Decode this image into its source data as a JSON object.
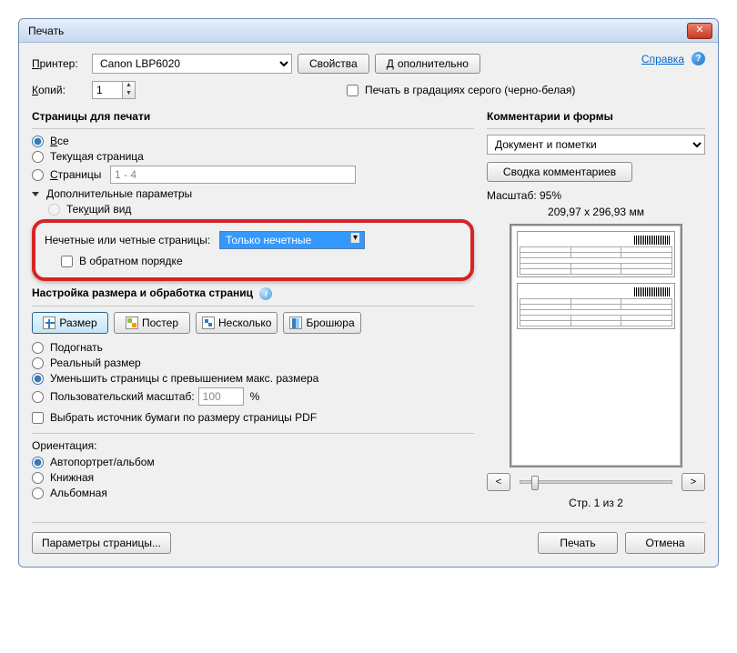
{
  "window": {
    "title": "Печать"
  },
  "toolbar": {
    "printer_label": "Принтер:",
    "printer_value": "Canon LBP6020",
    "properties": "Свойства",
    "advanced": "Дополнительно",
    "help_link": "Справка",
    "copies_label": "Копий:",
    "copies_value": "1",
    "grayscale": "Печать в градациях серого (черно-белая)"
  },
  "pages": {
    "title": "Страницы для печати",
    "all": "Все",
    "current": "Текущая страница",
    "range_label": "Страницы",
    "range_value": "1 - 4",
    "more_params": "Дополнительные параметры",
    "current_view": "Текущий вид",
    "odd_even_label": "Нечетные или четные страницы:",
    "odd_even_value": "Только нечетные",
    "reverse": "В обратном порядке"
  },
  "sizing": {
    "title": "Настройка размера и обработка страниц",
    "tabs": {
      "size": "Размер",
      "poster": "Постер",
      "multiple": "Несколько",
      "booklet": "Брошюра"
    },
    "fit": "Подогнать",
    "actual": "Реальный размер",
    "shrink": "Уменьшить страницы с превышением макс. размера",
    "custom": "Пользовательский масштаб:",
    "custom_value": "100",
    "percent": "%",
    "source_by_pdf": "Выбрать источник бумаги по размеру страницы PDF"
  },
  "orientation": {
    "title": "Ориентация:",
    "auto": "Автопортрет/альбом",
    "portrait": "Книжная",
    "landscape": "Альбомная"
  },
  "comments": {
    "title": "Комментарии и формы",
    "mode": "Документ и пометки",
    "summary": "Сводка комментариев"
  },
  "preview": {
    "scale_label": "Масштаб:  95%",
    "dims": "209,97 x 296,93 мм",
    "page_of": "Стр. 1 из 2",
    "prev": "<",
    "next": ">"
  },
  "footer": {
    "page_setup": "Параметры страницы...",
    "print": "Печать",
    "cancel": "Отмена"
  }
}
